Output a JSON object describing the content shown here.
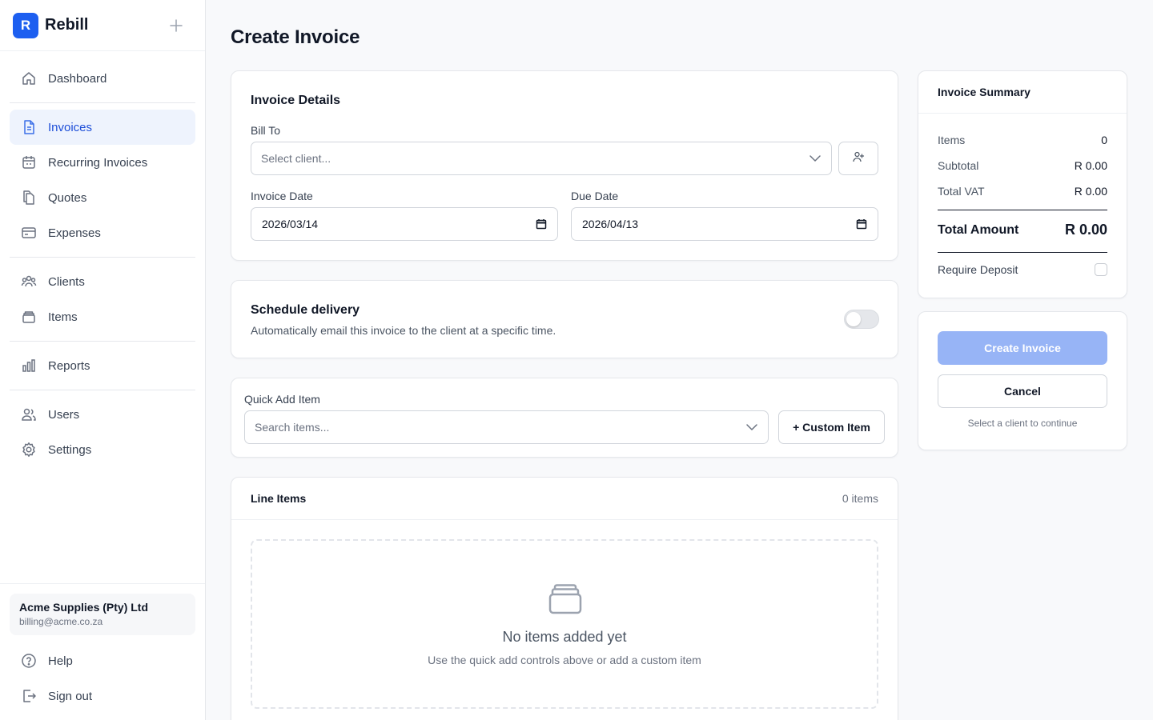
{
  "app": {
    "logo_letter": "R",
    "name": "Rebill"
  },
  "sidebar": {
    "items": [
      {
        "label": "Dashboard",
        "icon": "home-icon"
      },
      {
        "label": "Invoices",
        "icon": "document-icon",
        "active": true
      },
      {
        "label": "Recurring Invoices",
        "icon": "calendar-icon"
      },
      {
        "label": "Quotes",
        "icon": "files-icon"
      },
      {
        "label": "Expenses",
        "icon": "credit-card-icon"
      },
      {
        "label": "Clients",
        "icon": "clients-icon"
      },
      {
        "label": "Items",
        "icon": "box-icon"
      },
      {
        "label": "Reports",
        "icon": "bar-chart-icon"
      },
      {
        "label": "Users",
        "icon": "users-icon"
      },
      {
        "label": "Settings",
        "icon": "gear-icon"
      }
    ],
    "account": {
      "name": "Acme Supplies (Pty) Ltd",
      "email": "billing@acme.co.za"
    },
    "bottom": [
      {
        "label": "Help",
        "icon": "help-icon"
      },
      {
        "label": "Sign out",
        "icon": "sign-out-icon"
      }
    ]
  },
  "main": {
    "title": "Create Invoice",
    "invoice_details": {
      "title": "Invoice Details",
      "bill_to_label": "Bill To",
      "client_placeholder": "Select client...",
      "invoice_date_label": "Invoice Date",
      "invoice_date": "2026/03/14",
      "due_date_label": "Due Date",
      "due_date": "2026/04/13"
    },
    "schedule": {
      "title": "Schedule delivery",
      "description": "Automatically email this invoice to the client at a specific time.",
      "enabled": false
    },
    "quick_add": {
      "label": "Quick Add Item",
      "search_placeholder": "Search items...",
      "custom_button": "+ Custom Item"
    },
    "line_items": {
      "title": "Line Items",
      "count": "0 items",
      "empty_title": "No items added yet",
      "empty_text": "Use the quick add controls above or add a custom item"
    }
  },
  "summary": {
    "title": "Invoice Summary",
    "items_label": "Items",
    "items_value": "0",
    "subtotal_label": "Subtotal",
    "subtotal_value": "R 0.00",
    "vat_label": "Total VAT",
    "vat_value": "R 0.00",
    "total_label": "Total Amount",
    "total_value": "R 0.00",
    "deposit_label": "Require Deposit"
  },
  "actions": {
    "create_label": "Create Invoice",
    "cancel_label": "Cancel",
    "hint": "Select a client to continue"
  },
  "colors": {
    "accent": "#1d5ff0",
    "active_bg": "#eef3fd",
    "primary_disabled": "#97b4f6"
  }
}
